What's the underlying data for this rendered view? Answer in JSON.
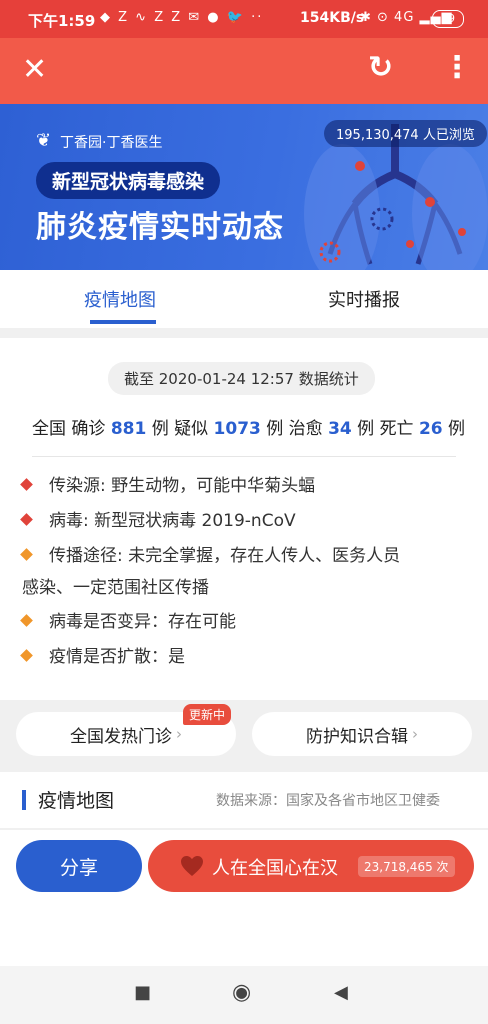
{
  "status_bar": {
    "time": "下午1:59",
    "icons": "◆ Z ∿ Z Z ✉ ● 🐦 ··",
    "speed": "154KB/s",
    "right_icons": "✱ ⊙ 4G ▂▄▆",
    "battery": "59"
  },
  "titlebar": {
    "close_glyph": "✕",
    "refresh_glyph": "↻",
    "menu_glyph": "⋮"
  },
  "banner": {
    "brand": "丁香园·丁香医生",
    "pill": "新型冠状病毒感染",
    "headline": "肺炎疫情实时动态",
    "views": "195,130,474 人已浏览"
  },
  "tabs": [
    {
      "label": "疫情地图",
      "active": true
    },
    {
      "label": "实时播报",
      "active": false
    }
  ],
  "summary": {
    "date_line": "截至 2020-01-24 12:57 数据统计",
    "prefix": "全国",
    "items": [
      {
        "label": "确诊",
        "value": "881",
        "unit": "例"
      },
      {
        "label": "疑似",
        "value": "1073",
        "unit": "例"
      },
      {
        "label": "治愈",
        "value": "34",
        "unit": "例"
      },
      {
        "label": "死亡",
        "value": "26",
        "unit": "例"
      }
    ]
  },
  "bullets": [
    {
      "text": "传染源: 野生动物，可能中华菊头蝠",
      "color": "#e0433a"
    },
    {
      "text": "病毒: 新型冠状病毒 2019-nCoV",
      "color": "#e0433a"
    },
    {
      "text": "传播途径: 未完全掌握，存在人传人、医务人员",
      "text2": "感染、一定范围社区传播",
      "color": "#f0962a"
    },
    {
      "text": "病毒是否变异：存在可能",
      "color": "#f0962a"
    },
    {
      "text": "疫情是否扩散：是",
      "color": "#f0962a"
    }
  ],
  "buttons": {
    "fever_clinic": "全国发热门诊",
    "new_badge": "更新中",
    "knowledge": "防护知识合辑",
    "chevron": "›"
  },
  "map_section": {
    "title": "疫情地图",
    "source": "数据来源：国家及各省市地区卫健委"
  },
  "share_bar": {
    "share": "分享",
    "heart_text": "人在全国心在汉",
    "count": "23,718,465 次"
  },
  "nav": {
    "recent": "■",
    "home": "◉",
    "back": "◀"
  },
  "colors": {
    "accent_blue": "#2a5fcf",
    "header_red": "#f25a49",
    "status_red": "#e6403a"
  }
}
